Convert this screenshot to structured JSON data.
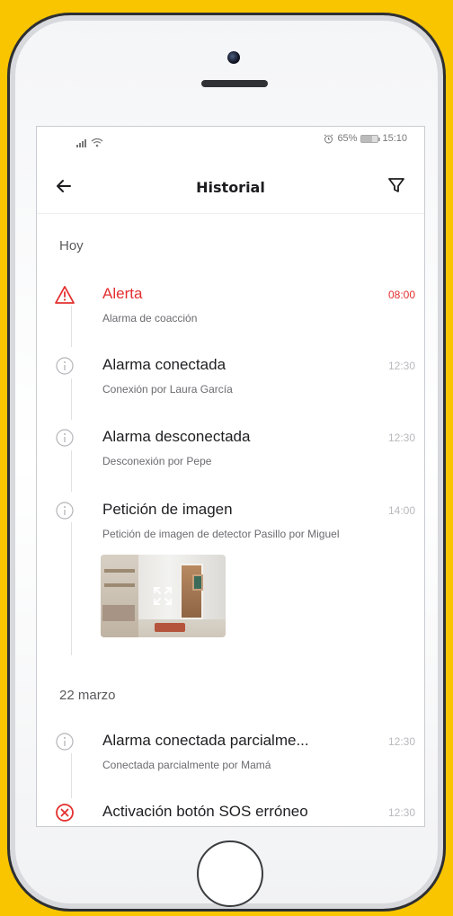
{
  "status_bar": {
    "alarm_icon": "alarm-clock-icon",
    "battery_text": "65%",
    "battery_level": 0.65,
    "time": "15:10"
  },
  "header": {
    "title": "Historial",
    "back_icon": "arrow-left-icon",
    "filter_icon": "filter-icon"
  },
  "sections": [
    {
      "title": "Hoy"
    },
    {
      "title": "22 marzo"
    }
  ],
  "events": [
    {
      "title": "Alerta",
      "subtitle": "Alarma de coacción",
      "time": "08:00",
      "icon": "warning-triangle-icon",
      "type": "alert"
    },
    {
      "title": "Alarma conectada",
      "subtitle": "Conexión por Laura García",
      "time": "12:30",
      "icon": "info-icon",
      "type": "info"
    },
    {
      "title": "Alarma desconectada",
      "subtitle": "Desconexión por Pepe",
      "time": "12:30",
      "icon": "info-icon",
      "type": "info"
    },
    {
      "title": "Petición de imagen",
      "subtitle": "Petición de imagen de detector Pasillo por Miguel",
      "time": "14:00",
      "icon": "info-icon",
      "type": "info",
      "has_image": true
    },
    {
      "title": "Alarma conectada parcialme...",
      "subtitle": "Conectada parcialmente por Mamá",
      "time": "12:30",
      "icon": "info-icon",
      "type": "info"
    },
    {
      "title": "Activación botón SOS erróneo",
      "subtitle": "",
      "time": "12:30",
      "icon": "error-x-icon",
      "type": "error"
    }
  ],
  "colors": {
    "alert": "#e3302f",
    "background": "#f8c500",
    "muted_time": "#b9b9be"
  }
}
